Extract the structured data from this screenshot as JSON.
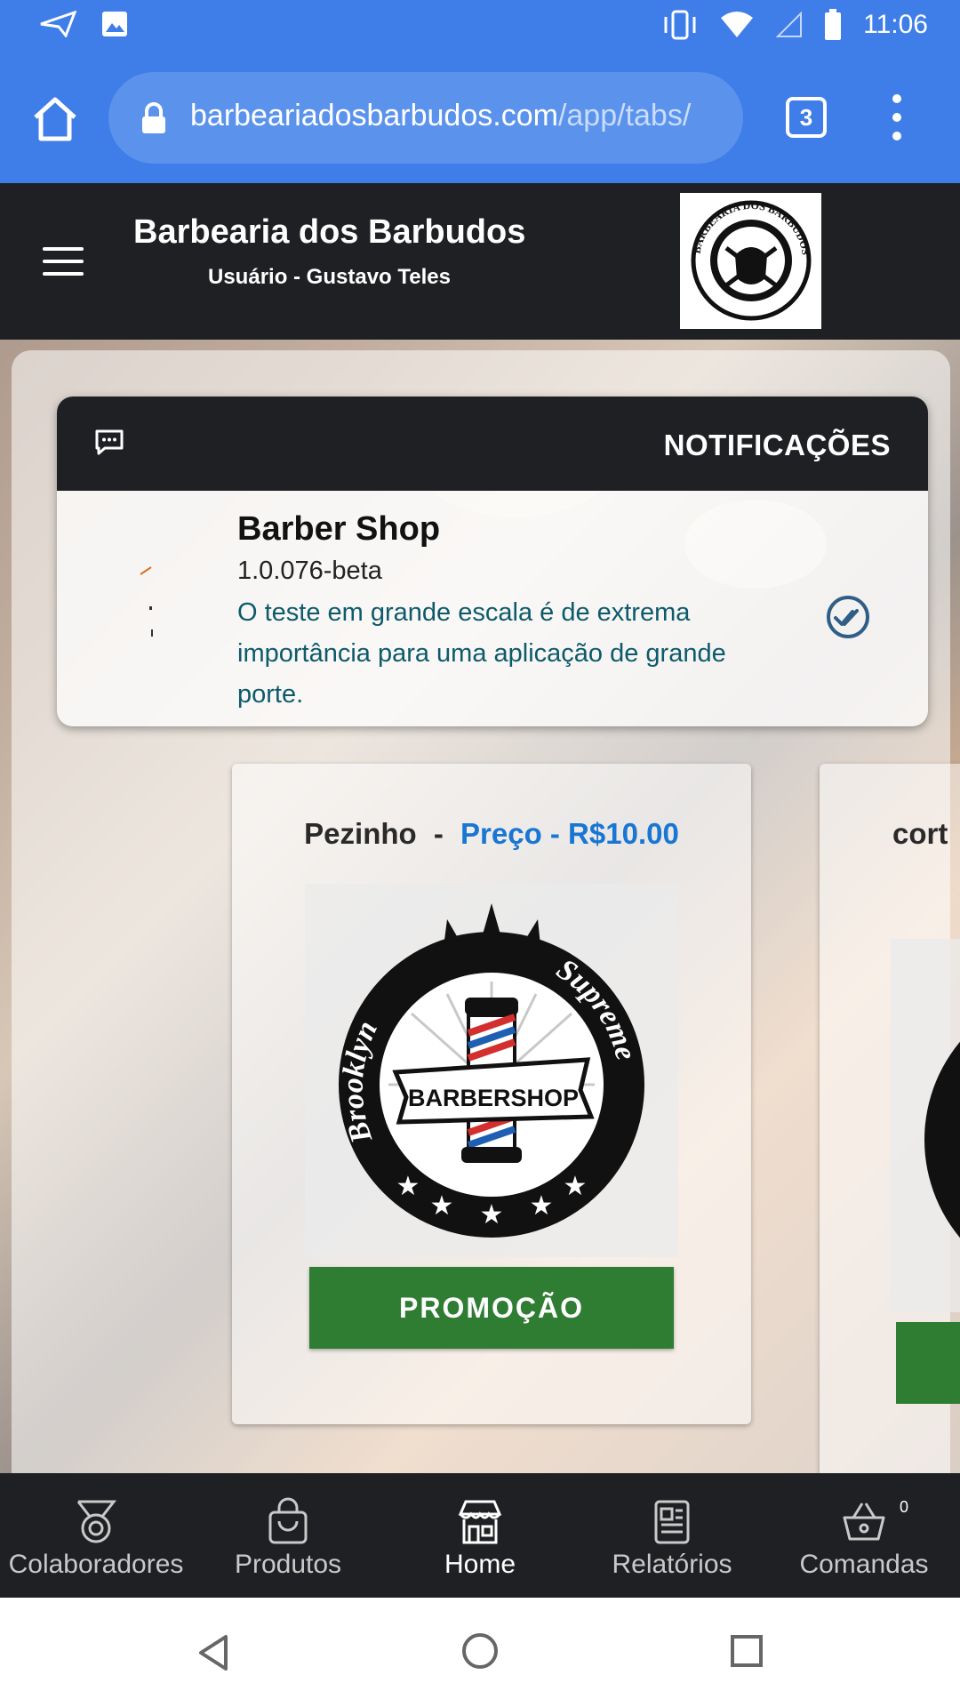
{
  "status_bar": {
    "time": "11:06"
  },
  "browser": {
    "url_domain": "barbeariadosbarbudos.com",
    "url_path": "/app/tabs/",
    "tab_count": "3"
  },
  "header": {
    "title": "Barbearia dos Barbudos",
    "user": "Usuário - Gustavo Teles",
    "logo_text": "BARBEARIA DOS BARBUDOS"
  },
  "notifications": {
    "heading": "NOTIFICAÇÕES",
    "item": {
      "name": "Barber Shop",
      "version": "1.0.076-beta",
      "message": "O teste em grande escala é de extrema importância para uma aplicação de grande porte."
    }
  },
  "products": [
    {
      "name": "Pezinho",
      "separator": "-",
      "price_label": "Preço - R$10.00",
      "button": "PROMOÇÃO",
      "image_text": {
        "left": "Brooklyn",
        "right": "Supreme",
        "center": "BARBERSHOP"
      }
    },
    {
      "name": "cort"
    }
  ],
  "bottom_nav": [
    {
      "label": "Colaboradores",
      "icon": "medal-icon"
    },
    {
      "label": "Produtos",
      "icon": "shopping-bag-icon"
    },
    {
      "label": "Home",
      "icon": "store-icon",
      "active": true
    },
    {
      "label": "Relatórios",
      "icon": "report-icon"
    },
    {
      "label": "Comandas",
      "icon": "basket-icon",
      "badge": "0"
    }
  ],
  "colors": {
    "browser_blue": "#3f7de8",
    "header_dark": "#1e2023",
    "price_blue": "#1976d2",
    "promo_green": "#2e7d32",
    "message_teal": "#0d5a6b"
  }
}
